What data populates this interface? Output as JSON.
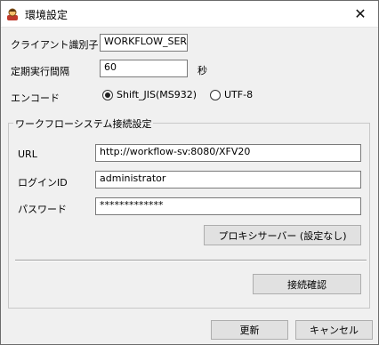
{
  "window": {
    "title": "環境設定",
    "close_glyph": "✕"
  },
  "fields": {
    "client_id": {
      "label": "クライアント識別子",
      "value": "WORKFLOW_SER\\"
    },
    "interval": {
      "label": "定期実行間隔",
      "value": "60",
      "unit": "秒"
    },
    "encode": {
      "label": "エンコード",
      "options": [
        {
          "label": "Shift_JIS(MS932)",
          "checked": true
        },
        {
          "label": "UTF-8",
          "checked": false
        }
      ]
    }
  },
  "group": {
    "title": "ワークフローシステム接続設定",
    "url": {
      "label": "URL",
      "value": "http://workflow-sv:8080/XFV20"
    },
    "login": {
      "label": "ログインID",
      "value": "administrator"
    },
    "password": {
      "label": "パスワード",
      "value": "*************"
    },
    "proxy_button": "プロキシサーバー (設定なし)",
    "test_button": "接続確認"
  },
  "footer": {
    "update_button": "更新",
    "cancel_button": "キャンセル"
  },
  "colors": {
    "window_bg": "#f0f0f0",
    "button_bg": "#e1e1e1",
    "titlebar_bg": "#ffffff"
  }
}
